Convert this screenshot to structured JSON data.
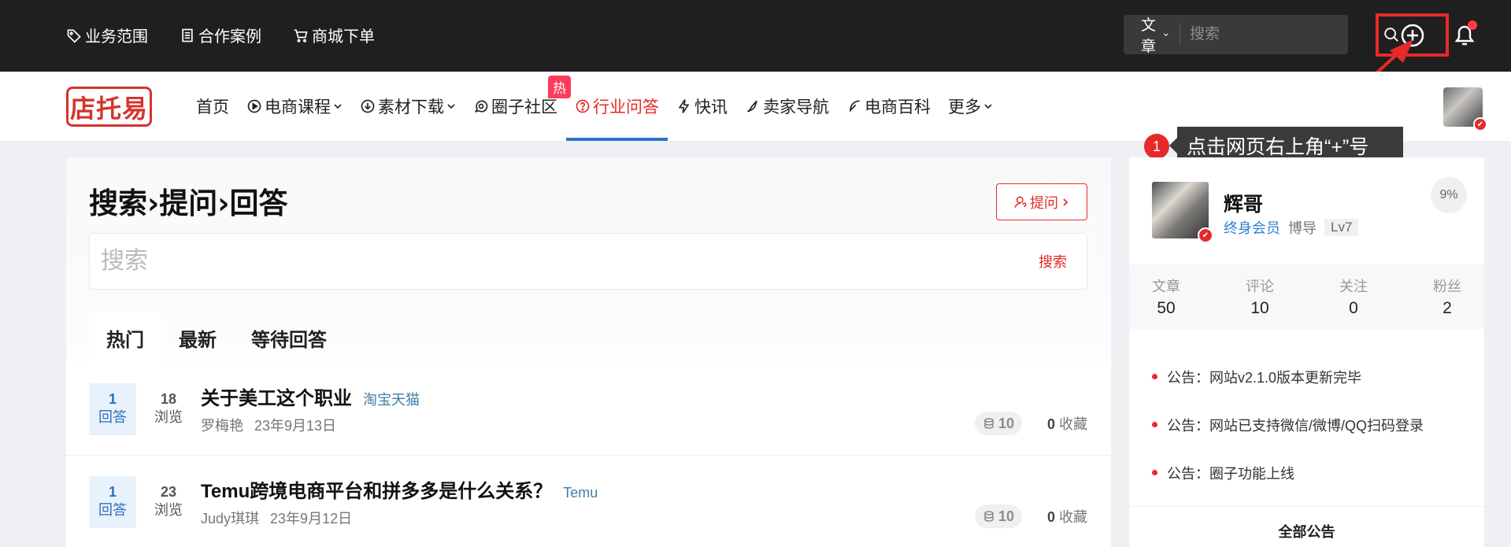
{
  "topbar": {
    "links": [
      {
        "label": "业务范围",
        "icon": "tag-icon"
      },
      {
        "label": "合作案例",
        "icon": "document-icon"
      },
      {
        "label": "商城下单",
        "icon": "cart-icon"
      }
    ],
    "search": {
      "select_label": "文章",
      "placeholder": "搜索"
    }
  },
  "nav": {
    "logo": "店托易",
    "items": [
      {
        "label": "首页"
      },
      {
        "label": "电商课程"
      },
      {
        "label": "素材下载"
      },
      {
        "label": "圈子社区",
        "badge": "热"
      },
      {
        "label": "行业问答"
      },
      {
        "label": "快讯"
      },
      {
        "label": "卖家导航"
      },
      {
        "label": "电商百科"
      },
      {
        "label": "更多"
      }
    ]
  },
  "callout": {
    "step": "1",
    "text": "点击网页右上角“+”号"
  },
  "main": {
    "title": "搜索›提问›回答",
    "ask_label": "提问",
    "search_placeholder": "搜索",
    "search_button": "搜索",
    "tabs": [
      "热门",
      "最新",
      "等待回答"
    ],
    "questions": [
      {
        "answers": "1",
        "answers_label": "回答",
        "views": "18",
        "views_label": "浏览",
        "title": "关于美工这个职业",
        "tag": "淘宝天猫",
        "author": "罗梅艳",
        "date": "23年9月13日",
        "coins": "10",
        "favs": "0",
        "favs_label": "收藏"
      },
      {
        "answers": "1",
        "answers_label": "回答",
        "views": "23",
        "views_label": "浏览",
        "title": "Temu跨境电商平台和拼多多是什么关系？",
        "tag": "Temu",
        "author": "Judy琪琪",
        "date": "23年9月12日",
        "coins": "10",
        "favs": "0",
        "favs_label": "收藏"
      }
    ]
  },
  "sidebar": {
    "name": "辉哥",
    "member": "终身会员",
    "role": "博导",
    "level": "Lv7",
    "percent": "9%",
    "stats": [
      {
        "label": "文章",
        "value": "50"
      },
      {
        "label": "评论",
        "value": "10"
      },
      {
        "label": "关注",
        "value": "0"
      },
      {
        "label": "粉丝",
        "value": "2"
      }
    ],
    "notices": [
      "公告：网站v2.1.0版本更新完毕",
      "公告：网站已支持微信/微博/QQ扫码登录",
      "公告：圈子功能上线"
    ],
    "all_notices": "全部公告"
  },
  "colors": {
    "accent": "#e8292a",
    "link": "#2f7fd3",
    "topbar": "#1f1f1f"
  }
}
